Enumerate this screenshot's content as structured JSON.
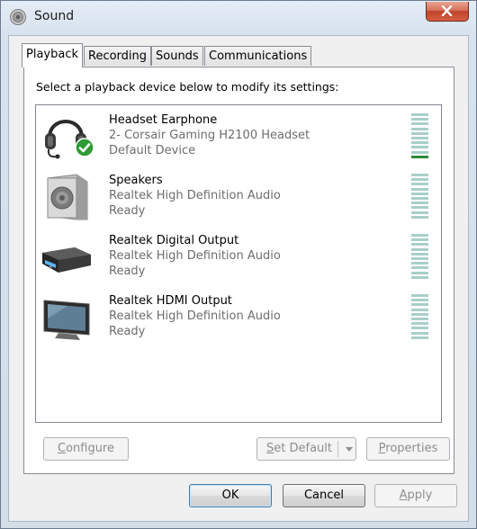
{
  "window": {
    "title": "Sound"
  },
  "tabs": [
    {
      "label": "Playback",
      "active": true
    },
    {
      "label": "Recording",
      "active": false
    },
    {
      "label": "Sounds",
      "active": false
    },
    {
      "label": "Communications",
      "active": false
    }
  ],
  "playback": {
    "instruction": "Select a playback device below to modify its settings:",
    "devices": [
      {
        "name": "Headset Earphone",
        "description": "2- Corsair Gaming H2100 Headset",
        "status": "Default Device",
        "icon": "headset-icon",
        "is_default": true,
        "level_segments_active": 1
      },
      {
        "name": "Speakers",
        "description": "Realtek High Definition Audio",
        "status": "Ready",
        "icon": "speaker-icon",
        "is_default": false,
        "level_segments_active": 0
      },
      {
        "name": "Realtek Digital Output",
        "description": "Realtek High Definition Audio",
        "status": "Ready",
        "icon": "digital-output-icon",
        "is_default": false,
        "level_segments_active": 0
      },
      {
        "name": "Realtek HDMI Output",
        "description": "Realtek High Definition Audio",
        "status": "Ready",
        "icon": "monitor-icon",
        "is_default": false,
        "level_segments_active": 0
      }
    ],
    "buttons": {
      "configure": "Configure",
      "set_default": "Set Default",
      "properties": "Properties"
    }
  },
  "footer": {
    "ok": "OK",
    "cancel": "Cancel",
    "apply": "Apply"
  },
  "colors": {
    "meter_idle": "#a9cfc9",
    "meter_active": "#2c8a3a",
    "default_check": "#2e9b34"
  }
}
